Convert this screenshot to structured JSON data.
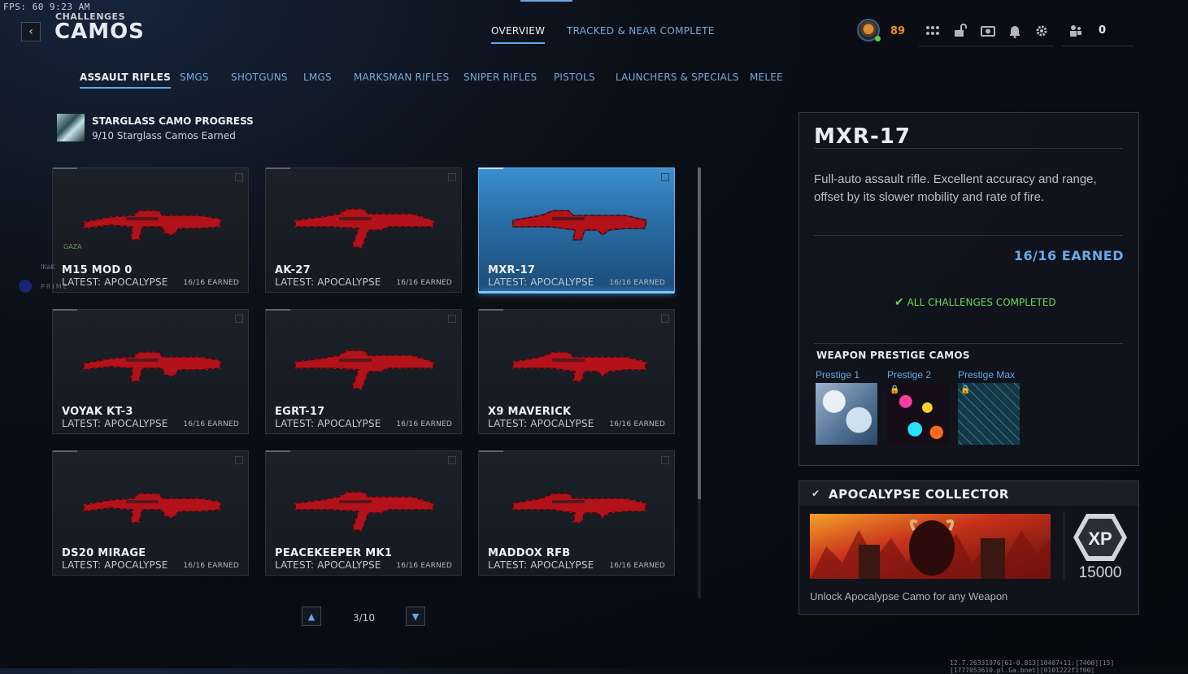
{
  "fps": "FPS:  60  9:23 AM",
  "breadcrumb": "CHALLENGES",
  "title": "CAMOS",
  "top_tabs": [
    {
      "label": "OVERVIEW",
      "active": true
    },
    {
      "label": "TRACKED & NEAR COMPLETE",
      "active": false
    }
  ],
  "player": {
    "level": "89",
    "friends_count": "0"
  },
  "top_icons": [
    "grid-icon",
    "unlock-icon",
    "camera-icon",
    "bell-icon",
    "gear-icon",
    "friends-icon"
  ],
  "categories": [
    {
      "label": "ASSAULT RIFLES",
      "active": true
    },
    {
      "label": "SMGS"
    },
    {
      "label": "SHOTGUNS"
    },
    {
      "label": "LMGS"
    },
    {
      "label": "MARKSMAN RIFLES"
    },
    {
      "label": "SNIPER RIFLES"
    },
    {
      "label": "PISTOLS"
    },
    {
      "label": "LAUNCHERS & SPECIALS"
    },
    {
      "label": "MELEE"
    }
  ],
  "starglass": {
    "title": "STARGLASS CAMO PROGRESS",
    "subtitle": "9/10 Starglass Camos Earned"
  },
  "weapons": [
    {
      "name": "M15 MOD 0",
      "camo": "LATEST: APOCALYPSE",
      "earned": "16/16 EARNED"
    },
    {
      "name": "AK-27",
      "camo": "LATEST: APOCALYPSE",
      "earned": "16/16 EARNED"
    },
    {
      "name": "MXR-17",
      "camo": "LATEST: APOCALYPSE",
      "earned": "16/16 EARNED",
      "selected": true
    },
    {
      "name": "VOYAK KT-3",
      "camo": "LATEST: APOCALYPSE",
      "earned": "16/16 EARNED"
    },
    {
      "name": "EGRT-17",
      "camo": "LATEST: APOCALYPSE",
      "earned": "16/16 EARNED"
    },
    {
      "name": "X9 MAVERICK",
      "camo": "LATEST: APOCALYPSE",
      "earned": "16/16 EARNED"
    },
    {
      "name": "DS20 MIRAGE",
      "camo": "LATEST: APOCALYPSE",
      "earned": "16/16 EARNED"
    },
    {
      "name": "PEACEKEEPER MK1",
      "camo": "LATEST: APOCALYPSE",
      "earned": "16/16 EARNED"
    },
    {
      "name": "MADDOX RFB",
      "camo": "LATEST: APOCALYPSE",
      "earned": "16/16 EARNED"
    }
  ],
  "pagination": {
    "label": "3/10"
  },
  "detail": {
    "name": "MXR-17",
    "description": "Full-auto assault rifle. Excellent accuracy and range, offset by its slower mobility and rate of fire.",
    "earned": "16/16 EARNED",
    "status": "ALL CHALLENGES COMPLETED",
    "prestige_title": "WEAPON PRESTIGE CAMOS",
    "prestige": [
      {
        "label": "Prestige 1",
        "locked": false
      },
      {
        "label": "Prestige 2",
        "locked": true
      },
      {
        "label": "Prestige Max",
        "locked": true
      }
    ]
  },
  "collector": {
    "title": "APOCALYPSE COLLECTOR",
    "description": "Unlock Apocalypse Camo for any Weapon",
    "xp_label": "XP",
    "xp_amount": "15000"
  },
  "overlay": [
    "GAZA",
    "IKaK",
    "PRIME"
  ],
  "build_string": "12.7.26331976[61-0.813]10407+11:[7400][15][1777053610.pl.Ga.bnet][0101222f1f00]",
  "colors": {
    "accent": "#6aa7e6",
    "complete": "#6bd85c",
    "level": "#f28d2c",
    "camo_red": "#b3121b"
  }
}
